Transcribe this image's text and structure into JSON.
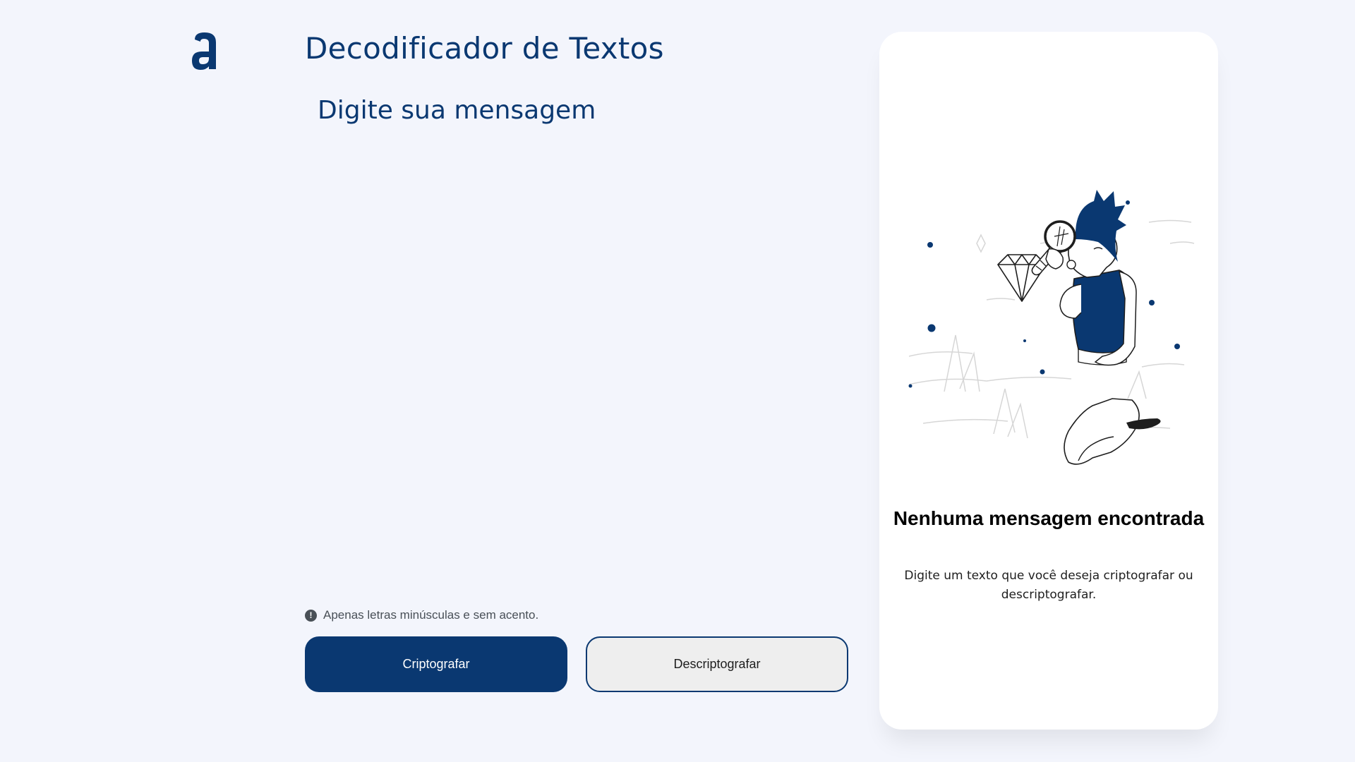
{
  "app": {
    "logo_icon": "alura-a-logo-icon",
    "title": "Decodificador de Textos"
  },
  "editor": {
    "placeholder": "Digite sua mensagem",
    "value": ""
  },
  "hint": {
    "icon": "exclamation-circle-icon",
    "text": "Apenas letras minúsculas e sem acento."
  },
  "actions": {
    "encrypt_label": "Criptografar",
    "decrypt_label": "Descriptografar"
  },
  "output": {
    "illustration": "person-with-magnifying-glass-and-diamond",
    "empty_title": "Nenhuma mensagem encontrada",
    "empty_text": "Digite um texto que você deseja criptografar ou descriptografar."
  },
  "colors": {
    "background": "#f3f5fc",
    "primary": "#0a3871",
    "panel": "#ffffff",
    "secondary_button": "#eeeeee"
  }
}
